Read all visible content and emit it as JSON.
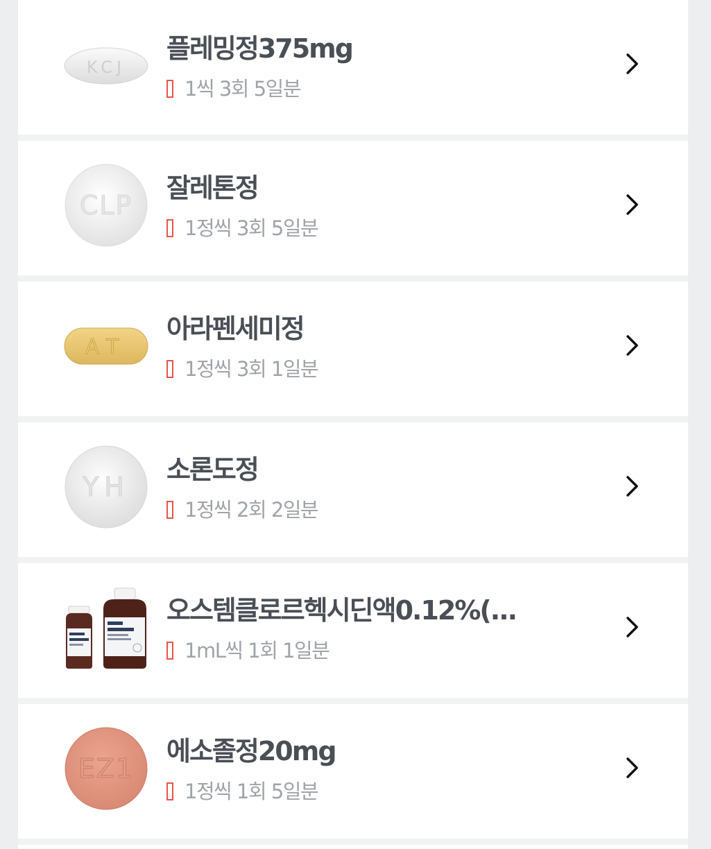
{
  "medications": [
    {
      "name": "플레밍정375mg",
      "dose": "1씩 3회 5일분",
      "image": "white-oval-tablet-icon",
      "imprint": "KCJ"
    },
    {
      "name": "잘레톤정",
      "dose": "1정씩 3회 5일분",
      "image": "white-round-tablet-icon",
      "imprint": "CLP"
    },
    {
      "name": "아라펜세미정",
      "dose": "1정씩 3회 1일분",
      "image": "yellow-oblong-tablet-icon",
      "imprint": "AT"
    },
    {
      "name": "소론도정",
      "dose": "1정씩 2회 2일분",
      "image": "white-round-tablet-icon",
      "imprint": "YH"
    },
    {
      "name": "오스템클로르헥시딘액0.12%(...",
      "dose": "1mL씩 1회 1일분",
      "image": "medicine-bottle-icon",
      "imprint": ""
    },
    {
      "name": "에소졸정20mg",
      "dose": "1정씩 1회 5일분",
      "image": "pink-round-tablet-icon",
      "imprint": "EZ1"
    }
  ],
  "colors": {
    "name": "#4a4f56",
    "dose": "#a0a4a9",
    "warn": "#e8544a",
    "background": "#eceeef"
  }
}
